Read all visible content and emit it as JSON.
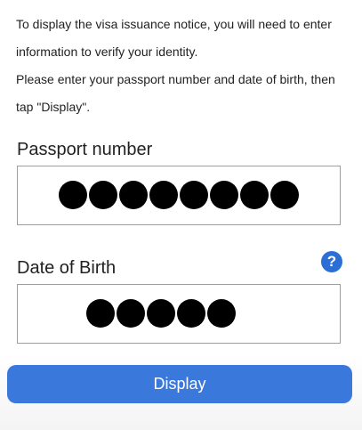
{
  "intro": {
    "line1": "To display the visa issuance notice, you will need to enter",
    "line2": "information to verify your identity.",
    "line3": "Please enter your passport number and date of birth, then",
    "line4": "tap \"Display\"."
  },
  "passport": {
    "label": "Passport number",
    "masked_char_count": 8
  },
  "date_of_birth": {
    "label": "Date of Birth",
    "help_icon": "question-mark-icon",
    "help_glyph": "?",
    "masked_char_count": 5
  },
  "actions": {
    "display_label": "Display"
  },
  "colors": {
    "accent": "#3a78db",
    "help_icon": "#2b6fd6",
    "mask_dot": "#000000"
  }
}
